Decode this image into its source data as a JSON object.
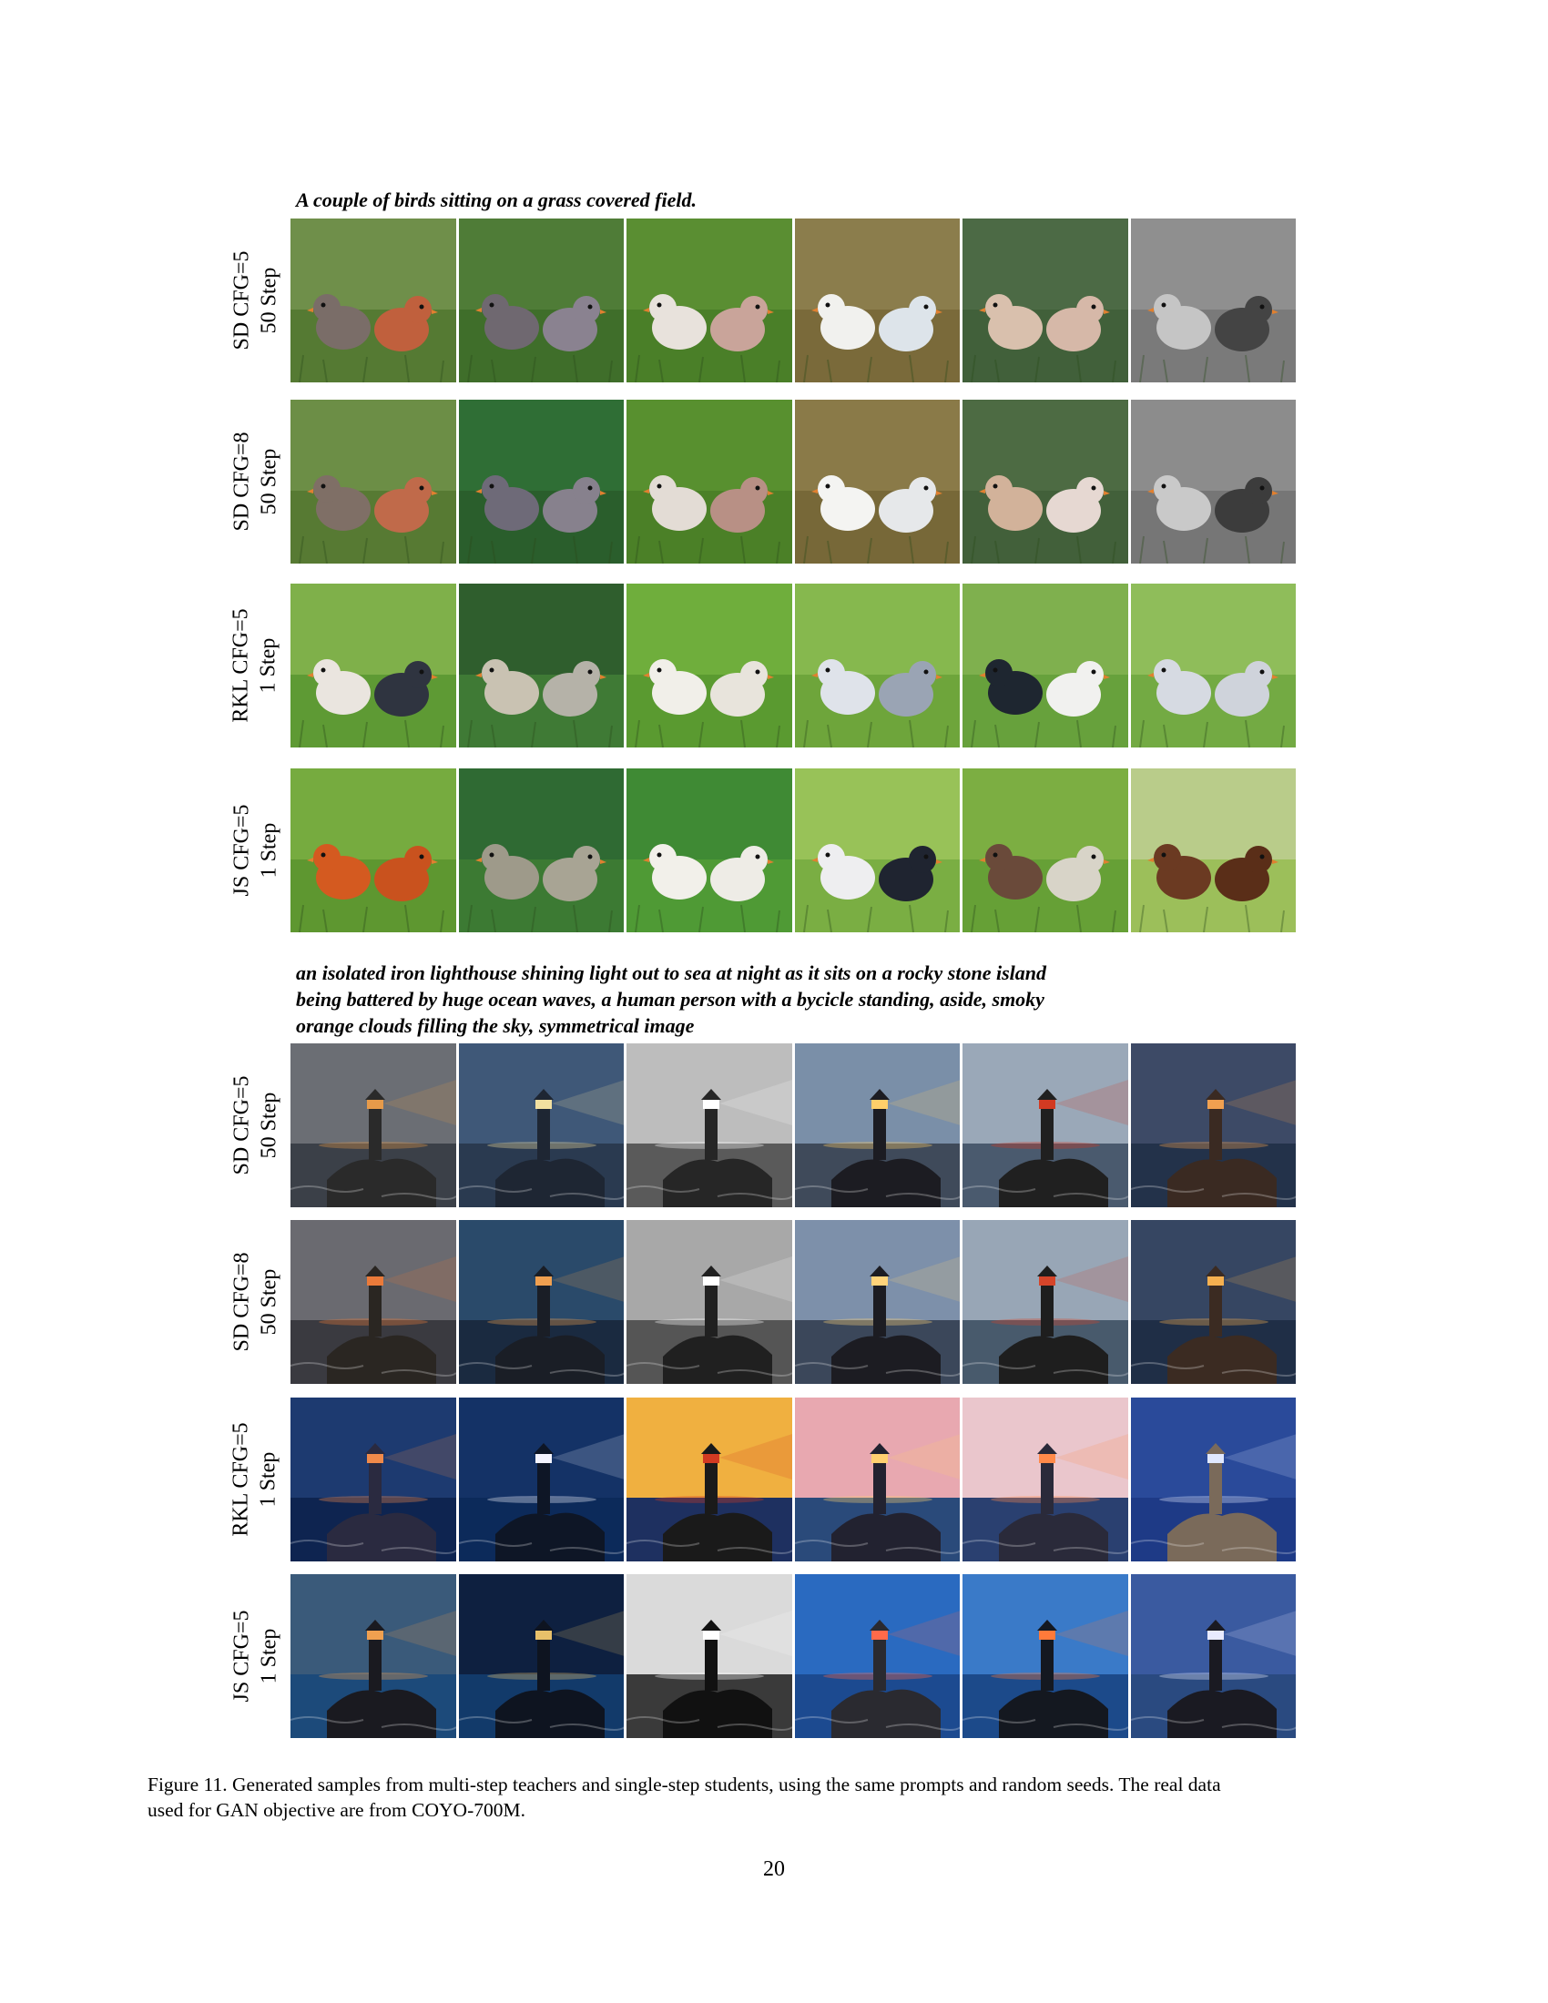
{
  "figure": {
    "sections": [
      {
        "prompt": "A couple of birds sitting on a grass covered field.",
        "theme": "birds",
        "rows": [
          {
            "label_line1": "SD CFG=5",
            "label_line2": "50 Step",
            "images": [
              {
                "icon": "birds-photo",
                "bg": "#6f8f4a",
                "ground": "#557a33",
                "a": "#7a6d68",
                "b": "#c0603d"
              },
              {
                "icon": "birds-photo",
                "bg": "#4f7c37",
                "ground": "#3f6e2a",
                "a": "#6f6870",
                "b": "#8a8290"
              },
              {
                "icon": "birds-photo",
                "bg": "#5a8e32",
                "ground": "#4a7f28",
                "a": "#e8e2dc",
                "b": "#c9a49a"
              },
              {
                "icon": "birds-photo",
                "bg": "#8b7d4c",
                "ground": "#7a6a3a",
                "a": "#f1f1ee",
                "b": "#dde4ea"
              },
              {
                "icon": "birds-photo",
                "bg": "#4c6a45",
                "ground": "#41603a",
                "a": "#d9c0ad",
                "b": "#d6b8a8"
              },
              {
                "icon": "birds-photo",
                "bg": "#8f8f8f",
                "ground": "#7a7a7a",
                "a": "#c5c5c5",
                "b": "#444444"
              }
            ]
          },
          {
            "label_line1": "SD CFG=8",
            "label_line2": "50 Step",
            "images": [
              {
                "icon": "birds-photo",
                "bg": "#6c8e46",
                "ground": "#577a33",
                "a": "#7f6f66",
                "b": "#c06a4a"
              },
              {
                "icon": "birds-photo",
                "bg": "#2f6e35",
                "ground": "#2a5e2c",
                "a": "#6e6a78",
                "b": "#87818d"
              },
              {
                "icon": "birds-photo",
                "bg": "#58902f",
                "ground": "#4b8027",
                "a": "#e3dcd5",
                "b": "#b89085"
              },
              {
                "icon": "birds-photo",
                "bg": "#8a7a48",
                "ground": "#776838",
                "a": "#f4f4f2",
                "b": "#e6e8ea"
              },
              {
                "icon": "birds-photo",
                "bg": "#4d6b43",
                "ground": "#42603a",
                "a": "#d2b29a",
                "b": "#e6d8d2"
              },
              {
                "icon": "birds-photo",
                "bg": "#8c8c8c",
                "ground": "#767676",
                "a": "#c9c9c9",
                "b": "#3c3c3c"
              }
            ]
          },
          {
            "label_line1": "RKL CFG=5",
            "label_line2": "1 Step",
            "images": [
              {
                "icon": "birds-photo",
                "bg": "#7fb04a",
                "ground": "#5e9a34",
                "a": "#eae5df",
                "b": "#2f3440"
              },
              {
                "icon": "birds-photo",
                "bg": "#2f5e2d",
                "ground": "#3f7a35",
                "a": "#c9c2b2",
                "b": "#b5b2a8"
              },
              {
                "icon": "birds-photo",
                "bg": "#6fae3c",
                "ground": "#5a9a30",
                "a": "#f1efe9",
                "b": "#e8e4dc"
              },
              {
                "icon": "birds-photo",
                "bg": "#86b84e",
                "ground": "#6ea53b",
                "a": "#dfe3ea",
                "b": "#9aa4b4"
              },
              {
                "icon": "birds-photo",
                "bg": "#7fb04e",
                "ground": "#67a13c",
                "a": "#1e2630",
                "b": "#f1f1ef"
              },
              {
                "icon": "birds-photo",
                "bg": "#8fbd5a",
                "ground": "#73aa43",
                "a": "#d6dae2",
                "b": "#cfd3db"
              }
            ]
          },
          {
            "label_line1": "JS CFG=5",
            "label_line2": "1 Step",
            "images": [
              {
                "icon": "birds-photo",
                "bg": "#76ab3f",
                "ground": "#5e9730",
                "a": "#d45a20",
                "b": "#c9521e"
              },
              {
                "icon": "birds-photo",
                "bg": "#2f6a33",
                "ground": "#3c7a33",
                "a": "#9e9a8a",
                "b": "#a8a494"
              },
              {
                "icon": "birds-photo",
                "bg": "#3f8a34",
                "ground": "#4f9a35",
                "a": "#f2f0ea",
                "b": "#eeece6"
              },
              {
                "icon": "birds-photo",
                "bg": "#98c258",
                "ground": "#7aae43",
                "a": "#eeeef0",
                "b": "#1f2430"
              },
              {
                "icon": "birds-photo",
                "bg": "#7cae42",
                "ground": "#66a036",
                "a": "#6a4a3a",
                "b": "#d8d4c8"
              },
              {
                "icon": "birds-photo",
                "bg": "#b9cc8a",
                "ground": "#9cbf5a",
                "a": "#6b3a22",
                "b": "#5a2e18"
              }
            ]
          }
        ]
      },
      {
        "prompt_lines": [
          "an isolated iron lighthouse shining light out to sea at night as it sits on a rocky stone island",
          "being battered by huge ocean waves, a human person with a bycicle standing, aside, smoky",
          "orange clouds filling the sky, symmetrical image"
        ],
        "theme": "lighthouse",
        "rows": [
          {
            "label_line1": "SD CFG=5",
            "label_line2": "50 Step",
            "images": [
              {
                "icon": "lighthouse-photo",
                "sky": "#6b6e74",
                "sea": "#3b4048",
                "light": "#e69a4a",
                "rock": "#2a2a2a"
              },
              {
                "icon": "lighthouse-photo",
                "sky": "#3f5878",
                "sea": "#2a3a50",
                "light": "#f2e0a0",
                "rock": "#1e2633"
              },
              {
                "icon": "lighthouse-photo",
                "sky": "#bdbdbd",
                "sea": "#5a5a5a",
                "light": "#ffffff",
                "rock": "#262626"
              },
              {
                "icon": "lighthouse-photo",
                "sky": "#7a8fa8",
                "sea": "#3f4a5a",
                "light": "#ffcf6a",
                "rock": "#1c1c22"
              },
              {
                "icon": "lighthouse-photo",
                "sky": "#9aa8b8",
                "sea": "#4a5a6e",
                "light": "#d23a22",
                "rock": "#202020"
              },
              {
                "icon": "lighthouse-photo",
                "sky": "#3d4a66",
                "sea": "#23324a",
                "light": "#f0a050",
                "rock": "#3a2a22"
              }
            ]
          },
          {
            "label_line1": "SD CFG=8",
            "label_line2": "50 Step",
            "images": [
              {
                "icon": "lighthouse-photo",
                "sky": "#6a6a70",
                "sea": "#3a3a40",
                "light": "#ea7a3a",
                "rock": "#2a2622"
              },
              {
                "icon": "lighthouse-photo",
                "sky": "#2a4a6a",
                "sea": "#1a2a40",
                "light": "#f0a050",
                "rock": "#1a1e26"
              },
              {
                "icon": "lighthouse-photo",
                "sky": "#a8a8a8",
                "sea": "#555555",
                "light": "#ffffff",
                "rock": "#202020"
              },
              {
                "icon": "lighthouse-photo",
                "sky": "#7d90aa",
                "sea": "#3b475a",
                "light": "#ffd37a",
                "rock": "#1c1c22"
              },
              {
                "icon": "lighthouse-photo",
                "sky": "#98a6b6",
                "sea": "#485a6c",
                "light": "#d5452a",
                "rock": "#1e1e1e"
              },
              {
                "icon": "lighthouse-photo",
                "sky": "#364662",
                "sea": "#1f2e46",
                "light": "#f5b050",
                "rock": "#3b2b22"
              }
            ]
          },
          {
            "label_line1": "RKL CFG=5",
            "label_line2": "1 Step",
            "images": [
              {
                "icon": "lighthouse-photo",
                "sky": "#1d3a70",
                "sea": "#0e2450",
                "light": "#f08a4a",
                "rock": "#2a2a40"
              },
              {
                "icon": "lighthouse-photo",
                "sky": "#143266",
                "sea": "#0c2a5a",
                "light": "#f4f4ff",
                "rock": "#0e1626"
              },
              {
                "icon": "lighthouse-photo",
                "sky": "#f0b040",
                "sea": "#1e3060",
                "light": "#d23a22",
                "rock": "#1a1a1a"
              },
              {
                "icon": "lighthouse-photo",
                "sky": "#e8a8b0",
                "sea": "#2a4a7a",
                "light": "#ffd070",
                "rock": "#222230"
              },
              {
                "icon": "lighthouse-photo",
                "sky": "#eac6cc",
                "sea": "#2a4070",
                "light": "#ff8a4a",
                "rock": "#2a2a3a"
              },
              {
                "icon": "lighthouse-photo",
                "sky": "#2a4a9a",
                "sea": "#1e3a86",
                "light": "#e0e8ff",
                "rock": "#7a6a5a"
              }
            ]
          },
          {
            "label_line1": "JS CFG=5",
            "label_line2": "1 Step",
            "images": [
              {
                "icon": "lighthouse-photo",
                "sky": "#3a5a7a",
                "sea": "#1c4a7a",
                "light": "#f0a050",
                "rock": "#1a1a20"
              },
              {
                "icon": "lighthouse-photo",
                "sky": "#0e2040",
                "sea": "#123a6a",
                "light": "#e8c06a",
                "rock": "#0e1420"
              },
              {
                "icon": "lighthouse-photo",
                "sky": "#dadada",
                "sea": "#3a3a3a",
                "light": "#ffffff",
                "rock": "#111111"
              },
              {
                "icon": "lighthouse-photo",
                "sky": "#2a6ac0",
                "sea": "#1c4a90",
                "light": "#ff6a4a",
                "rock": "#2a2a30"
              },
              {
                "icon": "lighthouse-photo",
                "sky": "#3a7ac8",
                "sea": "#1c4a8a",
                "light": "#ff7a3a",
                "rock": "#141820"
              },
              {
                "icon": "lighthouse-photo",
                "sky": "#3a5aa0",
                "sea": "#2a4a80",
                "light": "#e8eaff",
                "rock": "#1a1a22"
              }
            ]
          }
        ]
      }
    ]
  },
  "caption_line1": "Figure 11. Generated samples from multi-step teachers and single-step students, using the same prompts and random seeds. The real data",
  "caption_line2": "used for GAN objective are from COYO-700M.",
  "page_number": "20"
}
